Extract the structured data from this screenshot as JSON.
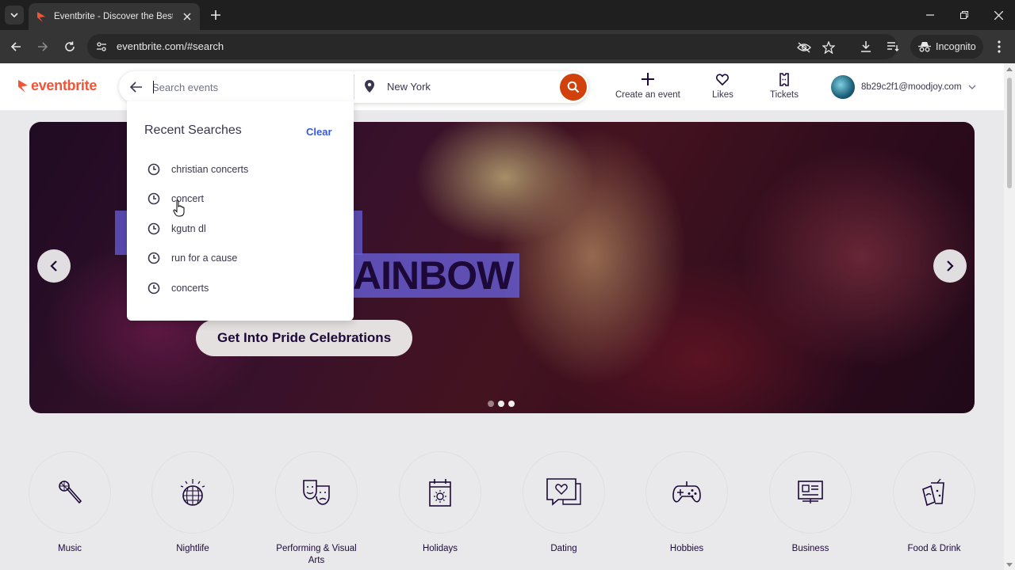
{
  "browser": {
    "tab_title": "Eventbrite - Discover the Best Lo",
    "url": "eventbrite.com/#search",
    "incognito_label": "Incognito"
  },
  "header": {
    "logo_text": "eventbrite",
    "search_placeholder": "Search events",
    "location": "New York",
    "create_event": "Create an event",
    "likes": "Likes",
    "tickets": "Tickets",
    "user_email": "8b29c2f1@moodjoy.com"
  },
  "dropdown": {
    "title": "Recent Searches",
    "clear": "Clear",
    "items": [
      {
        "label": "christian concerts"
      },
      {
        "label": "concert"
      },
      {
        "label": "kgutn dl"
      },
      {
        "label": "run for a cause"
      },
      {
        "label": "concerts"
      }
    ]
  },
  "hero": {
    "headline": "AINBOW",
    "cta": "Get Into Pride Celebrations",
    "slides_total": 3,
    "active_slide": 3
  },
  "categories": [
    {
      "label": "Music",
      "icon": "microphone-icon"
    },
    {
      "label": "Nightlife",
      "icon": "disco-ball-icon"
    },
    {
      "label": "Performing & Visual Arts",
      "icon": "theater-masks-icon"
    },
    {
      "label": "Holidays",
      "icon": "calendar-sun-icon"
    },
    {
      "label": "Dating",
      "icon": "chat-heart-icon"
    },
    {
      "label": "Hobbies",
      "icon": "gamepad-icon"
    },
    {
      "label": "Business",
      "icon": "presentation-icon"
    },
    {
      "label": "Food & Drink",
      "icon": "drinks-icon"
    }
  ],
  "colors": {
    "brand": "#f05537",
    "search_button": "#d1410c",
    "link": "#3659e3"
  }
}
